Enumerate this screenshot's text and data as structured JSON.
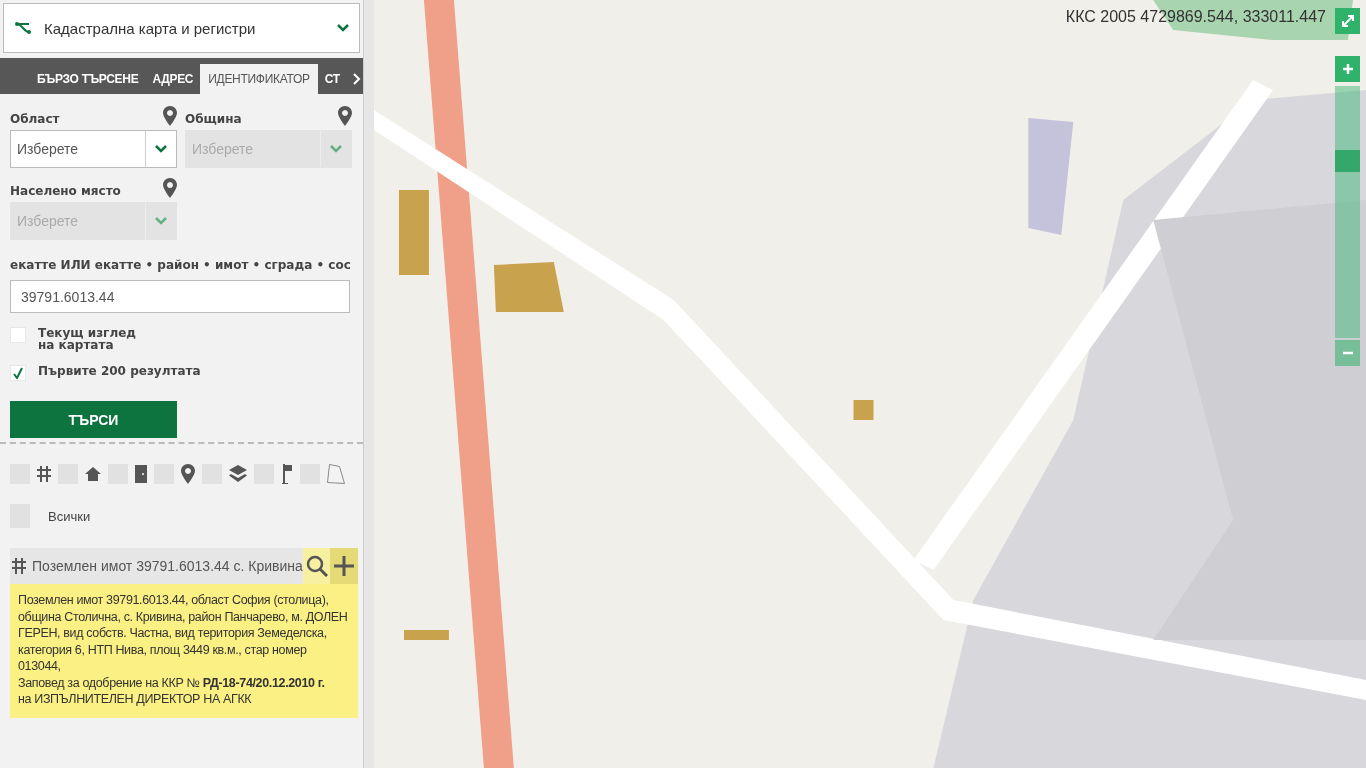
{
  "app_select": {
    "label": "Кадастрална карта и регистри"
  },
  "tabs": [
    {
      "label": "БЪРЗО ТЪРСЕНЕ",
      "selected": false
    },
    {
      "label": "АДРЕС",
      "selected": false
    },
    {
      "label": "ИДЕНТИФИКАТОР",
      "selected": true
    },
    {
      "label": "СТ",
      "selected": false
    }
  ],
  "form": {
    "selects": [
      {
        "label": "Област",
        "placeholder": "Изберете",
        "disabled": false
      },
      {
        "label": "Община",
        "placeholder": "Изберете",
        "disabled": true
      },
      {
        "label": "Населено място",
        "placeholder": "Изберете",
        "disabled": true
      }
    ],
    "id_field": {
      "label": "екатте ИЛИ екатте • район • имот • сграда • сос",
      "value": "39791.6013.44"
    },
    "options": [
      {
        "label": "Текущ изглед на картата",
        "checked": false
      },
      {
        "label": "Първите 200 резултата",
        "checked": true
      }
    ],
    "search_button": "ТЪРСИ"
  },
  "filters": [
    {
      "kind": "grid",
      "checked": false
    },
    {
      "kind": "home",
      "checked": false
    },
    {
      "kind": "door",
      "checked": false
    },
    {
      "kind": "pin",
      "checked": false
    },
    {
      "kind": "layers",
      "checked": false
    },
    {
      "kind": "flag",
      "checked": false
    },
    {
      "kind": "polygon",
      "checked": false
    }
  ],
  "all_filter": {
    "label": "Всички",
    "checked": false
  },
  "result": {
    "title": "Поземлен имот 39791.6013.44 с. Кривина",
    "details": "Поземлен имот 39791.6013.44, област София (столица), община Столична, с. Кривина, район Панчарево, м. ДОЛЕН ГЕРЕН, вид собств. Частна, вид територия Земеделска, категория 6, НТП Нива, площ 3449 кв.м., стар номер 013044,\nЗаповед за одобрение на ККР № **РД-18-74/20.12.2010 г.**\nна ИЗПЪЛНИТЕЛЕН ДИРЕКТОР НА АГКК"
  },
  "map": {
    "kind": "picture",
    "coordinates": "ККС 2005 4729869.544, 333011.447",
    "zoom": {
      "level": 0.72
    }
  }
}
